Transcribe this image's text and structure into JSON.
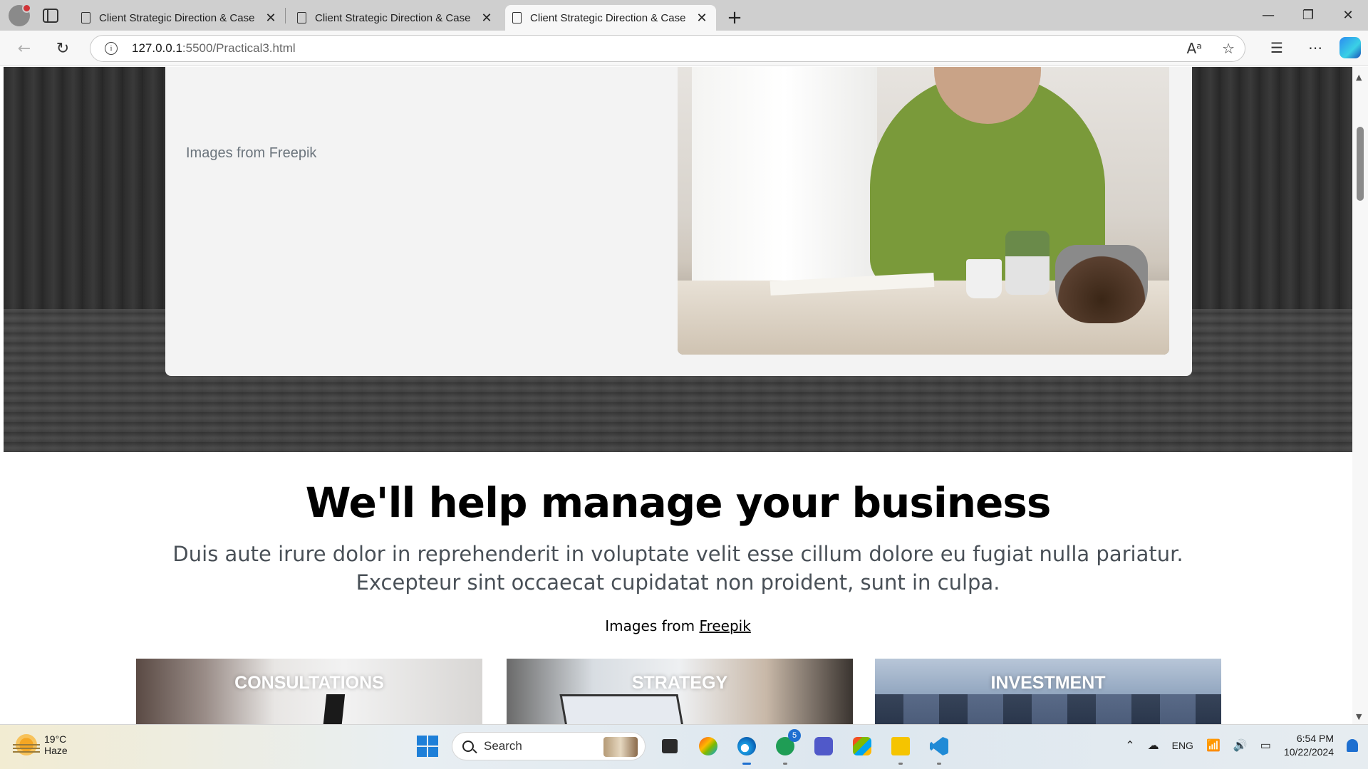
{
  "browser": {
    "tabs": [
      {
        "title": "Client Strategic Direction & Case Studies",
        "active": false
      },
      {
        "title": "Client Strategic Direction & Case Studies",
        "active": false
      },
      {
        "title": "Client Strategic Direction & Case Studies",
        "active": true
      }
    ],
    "new_tab": "+",
    "url_host": "127.0.0.1",
    "url_rest": ":5500/Practical3.html",
    "window_controls": {
      "minimize": "—",
      "restore": "❐",
      "close": "✕"
    }
  },
  "hero": {
    "caption": "Images from Freepik"
  },
  "services_section": {
    "title": "We'll help manage your business",
    "lead": "Duis aute irure dolor in reprehenderit in voluptate velit esse cillum dolore eu fugiat nulla pariatur. Excepteur sint occaecat cupidatat non proident, sunt in culpa.",
    "credit_prefix": "Images from ",
    "credit_link": "Freepik",
    "cards": [
      {
        "title": "CONSULTATIONS"
      },
      {
        "title": "STRATEGY"
      },
      {
        "title": "INVESTMENT"
      }
    ]
  },
  "taskbar": {
    "weather_temp": "19°C",
    "weather_condition": "Haze",
    "search_placeholder": "Search",
    "whatsapp_badge": "5",
    "language": "ENG",
    "time": "6:54 PM",
    "date": "10/22/2024"
  },
  "icons": [
    "profile-icon",
    "tab-actions-icon",
    "page-icon",
    "close-icon",
    "back-icon",
    "refresh-icon",
    "info-icon",
    "read-aloud-icon",
    "favorite-star-icon",
    "favorites-icon",
    "more-icon",
    "copilot-icon",
    "windows-start-icon",
    "search-icon",
    "task-view-icon",
    "copilot-app-icon",
    "edge-icon",
    "whatsapp-icon",
    "teams-icon",
    "store-icon",
    "file-explorer-icon",
    "vscode-icon",
    "chevron-up-icon",
    "cloud-icon",
    "wifi-icon",
    "volume-icon",
    "battery-icon",
    "notification-bell-icon"
  ]
}
